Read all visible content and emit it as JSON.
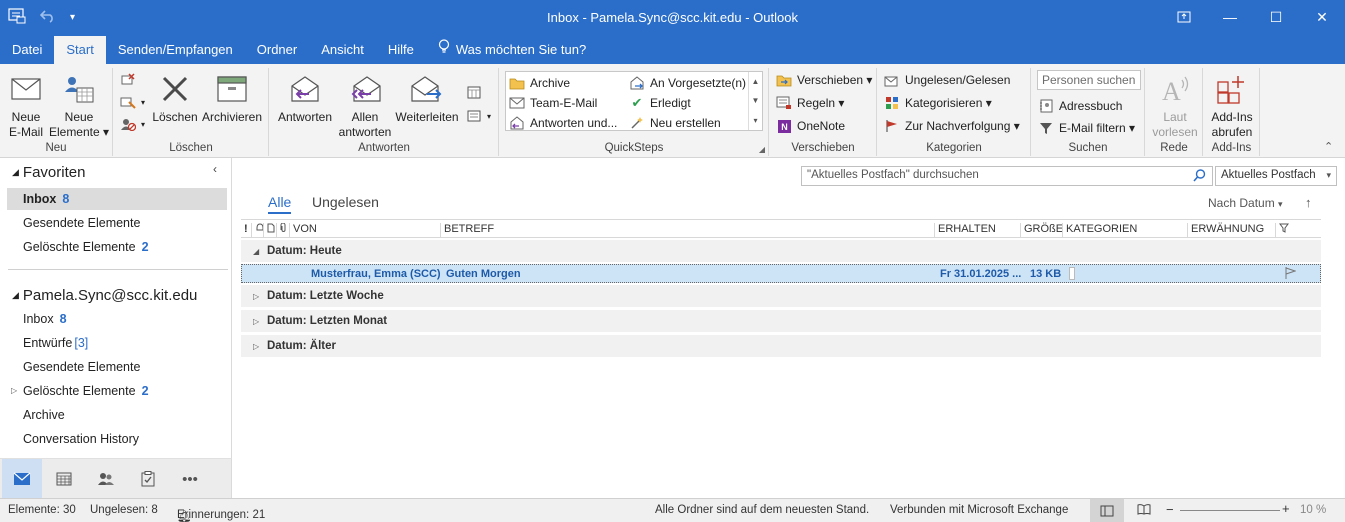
{
  "window": {
    "title": "Inbox - Pamela.Sync@scc.kit.edu  -  Outlook",
    "controls": {
      "restore_icon": "ribbon-display-icon",
      "minimize": "—",
      "maximize": "☐",
      "close": "✕"
    }
  },
  "menu": {
    "tabs": [
      "Datei",
      "Start",
      "Senden/Empfangen",
      "Ordner",
      "Ansicht",
      "Hilfe"
    ],
    "active_tab": "Start",
    "tell_me": "Was möchten Sie tun?"
  },
  "ribbon": {
    "neu": {
      "label": "Neu",
      "new_email": "Neue\nE-Mail",
      "new_email_l1": "Neue",
      "new_email_l2": "E-Mail",
      "new_items_l1": "Neue",
      "new_items_l2": "Elemente ▾"
    },
    "loeschen": {
      "label": "Löschen",
      "delete": "Löschen",
      "archive": "Archivieren"
    },
    "antworten": {
      "label": "Antworten",
      "reply": "Antworten",
      "reply_all_l1": "Allen",
      "reply_all_l2": "antworten",
      "forward": "Weiterleiten"
    },
    "quicksteps": {
      "label": "QuickSteps",
      "items": [
        "Archive",
        "Team-E-Mail",
        "Antworten und...",
        "An Vorgesetzte(n)",
        "Erledigt",
        "Neu erstellen"
      ]
    },
    "verschieben": {
      "label": "Verschieben",
      "move": "Verschieben ▾",
      "rules": "Regeln ▾",
      "onenote": "OneNote"
    },
    "kategorien": {
      "label": "Kategorien",
      "unread_read": "Ungelesen/Gelesen",
      "categorize": "Kategorisieren ▾",
      "follow_up": "Zur Nachverfolgung ▾"
    },
    "suchen": {
      "label": "Suchen",
      "people_placeholder": "Personen suchen",
      "address_book": "Adressbuch",
      "filter_email": "E-Mail filtern ▾"
    },
    "rede": {
      "label": "Rede",
      "read_aloud_l1": "Laut",
      "read_aloud_l2": "vorlesen"
    },
    "addins": {
      "label": "Add-Ins",
      "get_addins_l1": "Add-Ins",
      "get_addins_l2": "abrufen"
    }
  },
  "nav": {
    "favorites": {
      "title": "Favoriten",
      "items": [
        {
          "label": "Inbox",
          "count": "8"
        },
        {
          "label": "Gesendete Elemente",
          "count": ""
        },
        {
          "label": "Gelöschte Elemente",
          "count": "2"
        }
      ]
    },
    "account": {
      "title": "Pamela.Sync@scc.kit.edu",
      "items": [
        {
          "label": "Inbox",
          "count": "8"
        },
        {
          "label": "Entwürfe",
          "count": "[3]"
        },
        {
          "label": "Gesendete Elemente",
          "count": ""
        },
        {
          "label": "Gelöschte Elemente",
          "count": "2"
        },
        {
          "label": "Archive",
          "count": ""
        },
        {
          "label": "Conversation History",
          "count": ""
        }
      ]
    }
  },
  "mail": {
    "search_placeholder": "\"Aktuelles Postfach\" durchsuchen",
    "scope": "Aktuelles Postfach",
    "filter_tabs": [
      "Alle",
      "Ungelesen"
    ],
    "sort_label": "Nach Datum",
    "columns": {
      "icons": "!",
      "from": "VON",
      "subject": "BETREFF",
      "received": "ERHALTEN",
      "size": "GRÖßE",
      "categories": "KATEGORIEN",
      "mention": "ERWÄHNUNG"
    },
    "groups": [
      "Datum: Heute",
      "Datum: Letzte Woche",
      "Datum: Letzten Monat",
      "Datum: Älter"
    ],
    "message": {
      "from": "Musterfrau, Emma (SCC)",
      "subject": "Guten Morgen",
      "received": "Fr 31.01.2025 ...",
      "size": "13 KB"
    }
  },
  "status": {
    "items": "Elemente: 30",
    "unread": "Ungelesen: 8",
    "reminders": "Erinnerungen: 21",
    "sync": "Alle Ordner sind auf dem neuesten Stand.",
    "connection": "Verbunden mit Microsoft Exchange",
    "zoom": "10 %"
  }
}
